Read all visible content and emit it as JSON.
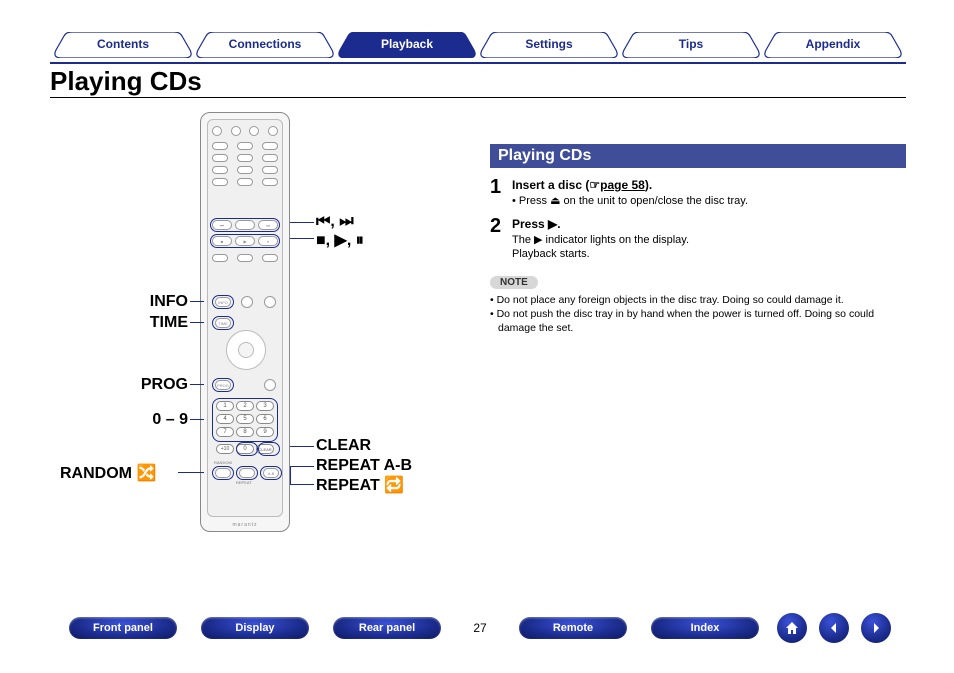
{
  "tabs": [
    "Contents",
    "Connections",
    "Playback",
    "Settings",
    "Tips",
    "Appendix"
  ],
  "active_tab_index": 2,
  "page_title": "Playing CDs",
  "remote_labels": {
    "info": "INFO",
    "time": "TIME",
    "prog": "PROG",
    "digits": "0 – 9",
    "random": "RANDOM",
    "skip": "⏮, ⏭",
    "transport": "■, ▶, ⏸",
    "clear": "CLEAR",
    "repeat_ab": "REPEAT A-B",
    "repeat": "REPEAT",
    "random_icon": "🔀",
    "repeat_icon": "🔁"
  },
  "section_title": "Playing CDs",
  "steps": [
    {
      "num": "1",
      "head_pre": "Insert a disc (☞",
      "head_link": "page 58",
      "head_post": ").",
      "sub": "• Press ⏏ on the unit to open/close the disc tray."
    },
    {
      "num": "2",
      "head": "Press ▶.",
      "sub1": "The ▶ indicator lights on the display.",
      "sub2": "Playback starts."
    }
  ],
  "note_label": "NOTE",
  "notes": [
    "Do not place any foreign objects in the disc tray. Doing so could damage it.",
    "Do not push the disc tray in by hand when the power is turned off. Doing so could damage the set."
  ],
  "footer": {
    "buttons_left": [
      "Front panel",
      "Display",
      "Rear panel"
    ],
    "page": "27",
    "buttons_right": [
      "Remote",
      "Index"
    ]
  }
}
